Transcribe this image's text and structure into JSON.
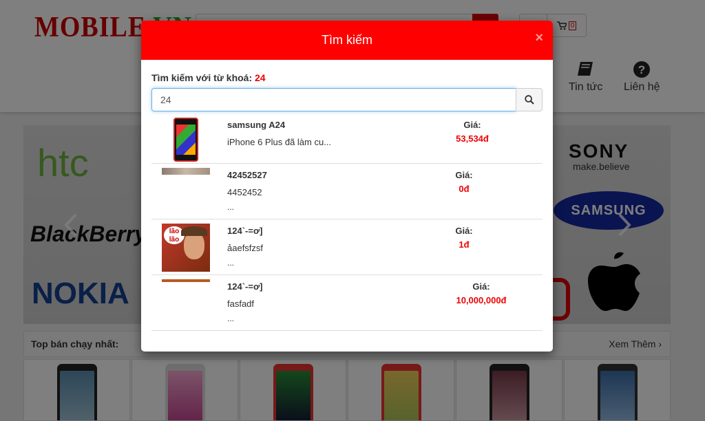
{
  "page": {
    "logo_main": "MOBILE",
    "logo_suffix": "VN",
    "nav": [
      {
        "label": "Tin tức"
      },
      {
        "label": "Liên hệ"
      }
    ],
    "cart_count": "0",
    "banner_brands": [
      "htc",
      "BlackBerry",
      "NOKIA",
      "SONY",
      "make.believe",
      "SAMSUNG"
    ],
    "top_section": {
      "title": "Top bán chạy nhất:",
      "more_label": "Xem Thêm ›"
    }
  },
  "modal": {
    "title": "Tìm kiếm",
    "close_label": "×",
    "query_prefix": "Tìm kiếm với từ khoá: ",
    "query_keyword": "24",
    "input_value": "24",
    "results": [
      {
        "name": "samsung A24",
        "desc": "iPhone 6 Plus đã làm cu...",
        "more": "",
        "price_label": "Giá:",
        "price": "53,534đ"
      },
      {
        "name": "42452527",
        "desc": "4452452",
        "more": "...",
        "price_label": "Giá:",
        "price": "0đ"
      },
      {
        "name": "124`-=ơ]",
        "desc": "ảaefsfzsf",
        "more": "...",
        "price_label": "Giá:",
        "price": "1đ"
      },
      {
        "name": "124`-=ơ]",
        "desc": "fasfadf",
        "more": "...",
        "price_label": "Giá:",
        "price": "10,000,000đ"
      }
    ]
  },
  "icons": [
    "search-icon",
    "user-icon",
    "cart-icon",
    "book-icon",
    "question-circle-icon",
    "close-icon",
    "chevron-left-icon",
    "chevron-right-icon"
  ],
  "colors": {
    "modal_header": "#ff0000",
    "price": "#ee0000",
    "brand_red": "#cc0000"
  }
}
